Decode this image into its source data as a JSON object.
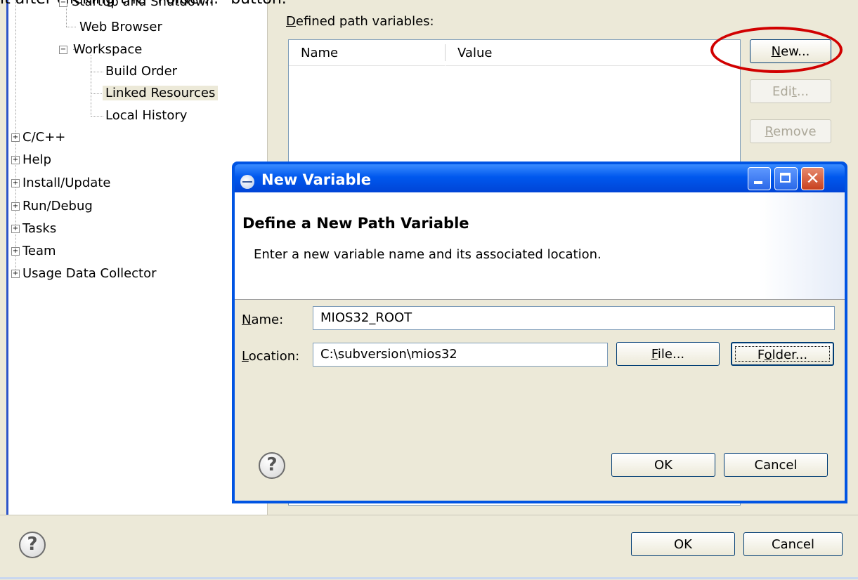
{
  "caption": "it after clicking the \"Folder...\" button.",
  "tree": {
    "items": [
      {
        "label": "Startup and Shutdown"
      },
      {
        "label": "Web Browser"
      },
      {
        "label": "Workspace"
      },
      {
        "label": "Build Order"
      },
      {
        "label": "Linked Resources"
      },
      {
        "label": "Local History"
      },
      {
        "label": "C/C++"
      },
      {
        "label": "Help"
      },
      {
        "label": "Install/Update"
      },
      {
        "label": "Run/Debug"
      },
      {
        "label": "Tasks"
      },
      {
        "label": "Team"
      },
      {
        "label": "Usage Data Collector"
      }
    ],
    "selected": "Linked Resources"
  },
  "path_vars": {
    "label_accel": "D",
    "label_rest": "efined path variables:",
    "columns": [
      "Name",
      "Value"
    ],
    "buttons": {
      "new": {
        "accel": "N",
        "rest": "ew..."
      },
      "edit": {
        "pre": "Edi",
        "accel": "t",
        "rest": "..."
      },
      "remove": {
        "accel": "R",
        "rest": "emove"
      }
    }
  },
  "dialog": {
    "title": "New Variable",
    "header_title": "Define a New Path Variable",
    "header_desc": "Enter a new variable name and its associated location.",
    "name_label": {
      "accel": "N",
      "rest": "ame:"
    },
    "name_value": "MIOS32_ROOT",
    "location_label": {
      "accel": "L",
      "rest": "ocation:"
    },
    "location_value": "C:\\subversion\\mios32",
    "file_button": {
      "accel": "F",
      "rest": "ile..."
    },
    "folder_button": {
      "pre": "F",
      "accel": "o",
      "rest": "lder..."
    },
    "ok": "OK",
    "cancel": "Cancel"
  },
  "footer": {
    "ok": "OK",
    "cancel": "Cancel"
  },
  "colors": {
    "titlebar": "#0058ee",
    "highlight_ellipse": "#d10000",
    "panel_bg": "#ece9d8"
  }
}
